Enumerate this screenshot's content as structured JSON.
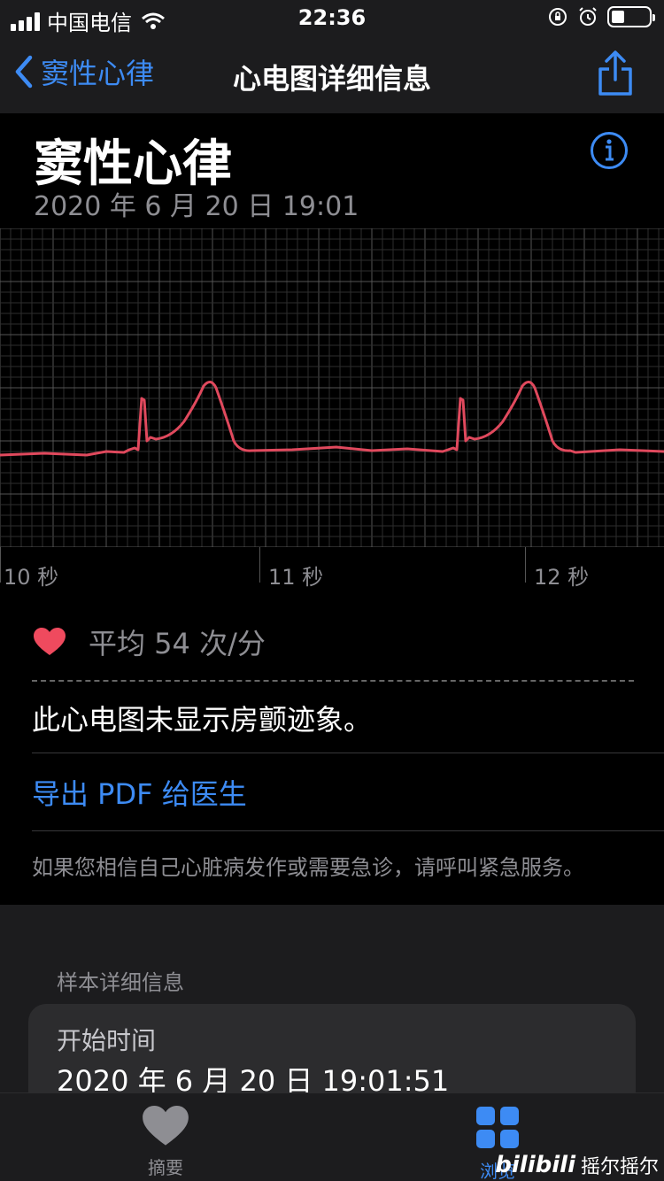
{
  "status_bar": {
    "carrier": "中国电信",
    "time": "22:36"
  },
  "nav": {
    "back_label": "窦性心律",
    "title": "心电图详细信息"
  },
  "header": {
    "title": "窦性心律",
    "datetime": "2020 年 6 月 20 日 19:01"
  },
  "ecg": {
    "time_labels": [
      "10 秒",
      "11 秒",
      "12 秒"
    ],
    "line_color": "#e0495d"
  },
  "average": {
    "text": "平均 54 次/分",
    "heart_color": "#ef4a5e"
  },
  "summary": "此心电图未显示房颤迹象。",
  "export_pdf": "导出 PDF 给医生",
  "disclaimer": "如果您相信自己心脏病发作或需要急诊，请呼叫紧急服务。",
  "sample_details": {
    "header": "样本详细信息",
    "start_time_label": "开始时间",
    "start_time_value": "2020 年 6 月 20 日 19:01:51"
  },
  "tabs": [
    {
      "label": "摘要",
      "icon": "heart-icon"
    },
    {
      "label": "浏览",
      "icon": "grid-icon"
    }
  ],
  "watermark": {
    "brand": "bilibili",
    "user": "摇尔摇尔"
  },
  "colors": {
    "accent": "#3d8bf4",
    "background": "#000000",
    "card": "#2c2c2e"
  }
}
